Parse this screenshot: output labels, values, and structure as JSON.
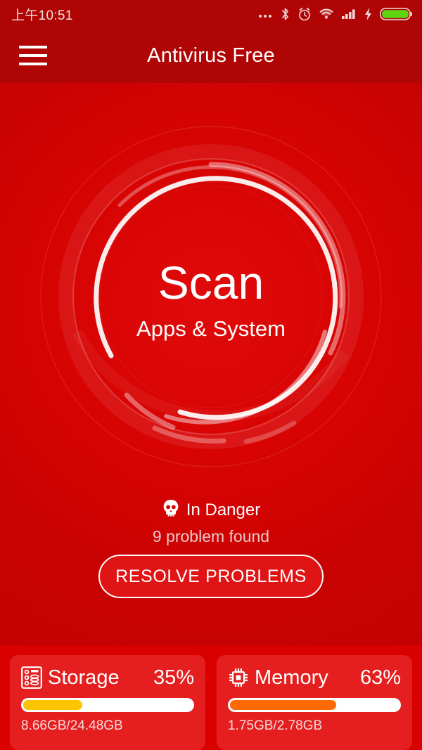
{
  "status_bar": {
    "time": "上午10:51",
    "icons": [
      "more-dots-icon",
      "bluetooth-icon",
      "alarm-clock-icon",
      "wifi-icon",
      "cellular-signal-icon",
      "charging-bolt-icon",
      "battery-icon"
    ],
    "battery_color": "#5fd411"
  },
  "app_bar": {
    "menu_icon": "hamburger-menu-icon",
    "title": "Antivirus Free"
  },
  "scan": {
    "title": "Scan",
    "subtitle": "Apps & System",
    "ring_color": "#ffffff"
  },
  "status": {
    "icon": "skull-icon",
    "danger_label": "In Danger",
    "problem_label": "9 problem found",
    "resolve_label": "RESOLVE PROBLEMS"
  },
  "cards": [
    {
      "icon": "storage-server-icon",
      "name": "Storage",
      "percent_label": "35%",
      "percent": 35,
      "detail": "8.66GB/24.48GB",
      "bar_color": "#ffc400"
    },
    {
      "icon": "memory-chip-icon",
      "name": "Memory",
      "percent_label": "63%",
      "percent": 63,
      "detail": "1.75GB/2.78GB",
      "bar_color": "#ff6a00"
    }
  ],
  "theme": {
    "background": "#d90000",
    "bar_background": "#b00505",
    "card_background": "#e51f1f"
  }
}
